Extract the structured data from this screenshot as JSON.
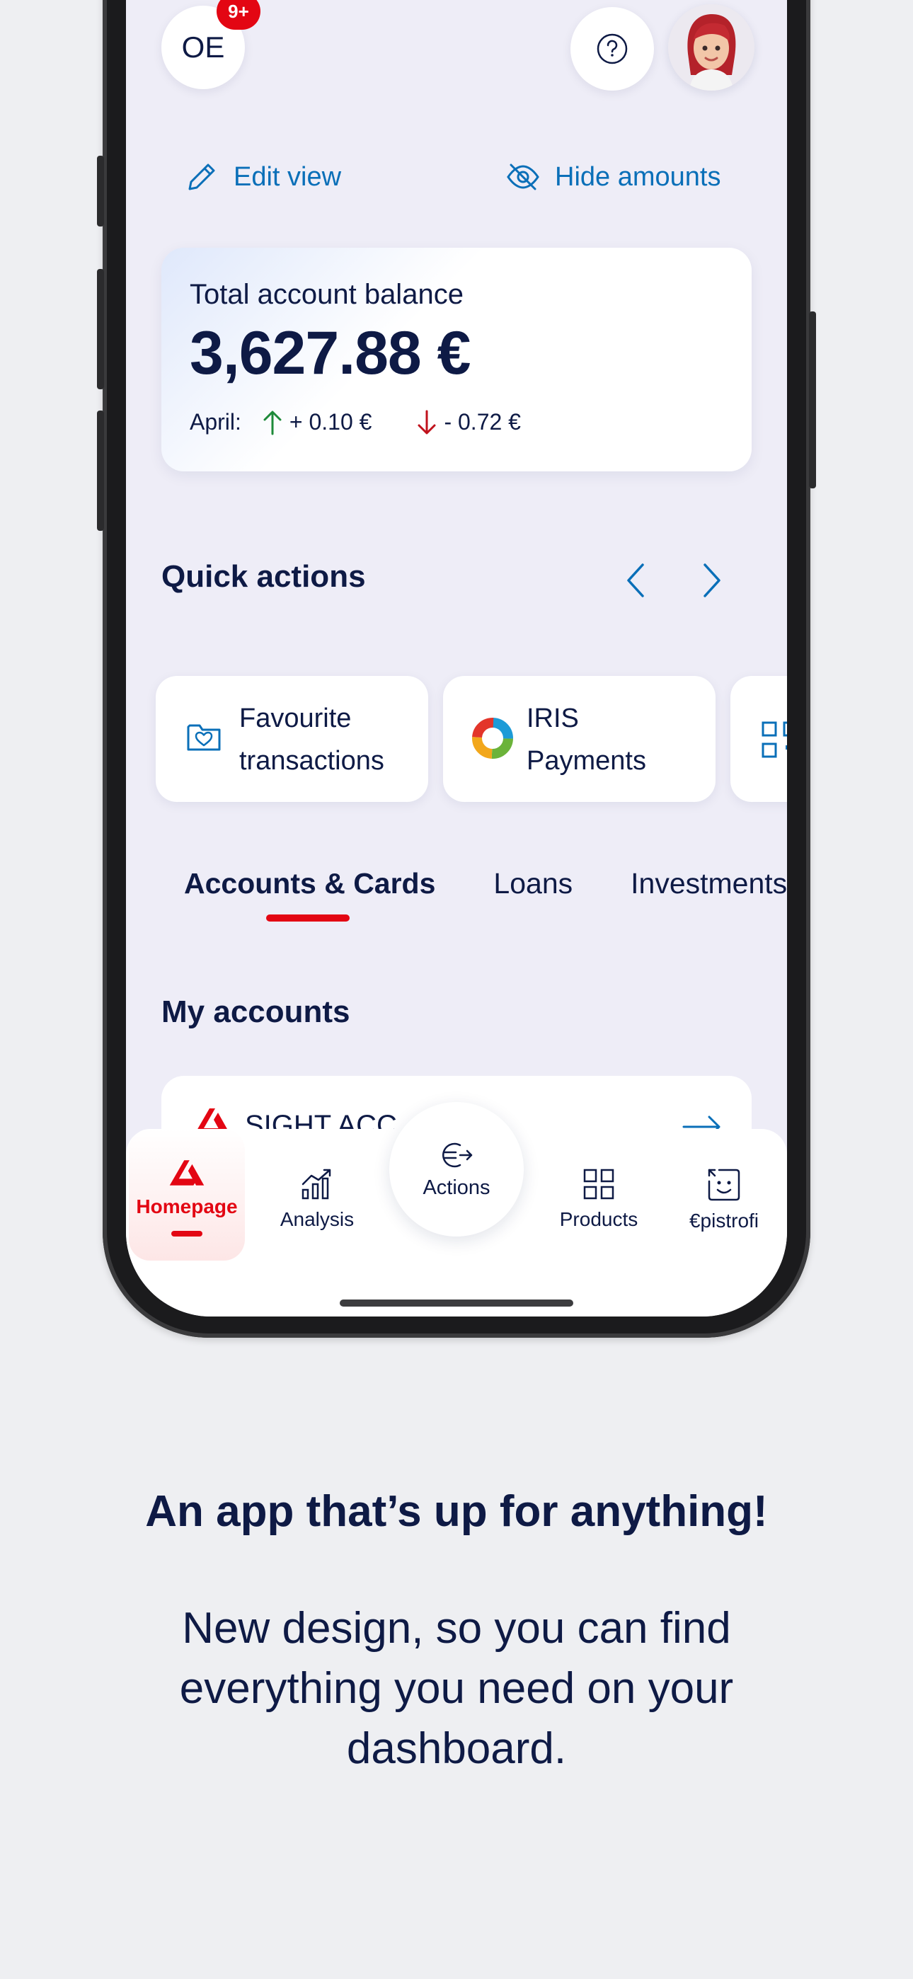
{
  "header": {
    "initials": "OE",
    "notification_count": "9+"
  },
  "view_controls": {
    "edit_label": "Edit view",
    "hide_label": "Hide amounts"
  },
  "balance": {
    "label": "Total account balance",
    "amount": "3,627.88 €",
    "month_label": "April:",
    "income": "+ 0.10 €",
    "expense": "- 0.72 €"
  },
  "quick_actions": {
    "title": "Quick actions",
    "items": [
      {
        "line1": "Favourite",
        "line2": "transactions",
        "icon": "folder-heart-icon"
      },
      {
        "line1": "IRIS",
        "line2": "Payments",
        "icon": "iris-logo-icon"
      }
    ]
  },
  "tabs": [
    {
      "label": "Accounts & Cards",
      "active": true
    },
    {
      "label": "Loans",
      "active": false
    },
    {
      "label": "Investments",
      "active": false
    }
  ],
  "accounts": {
    "title": "My accounts",
    "first_account": "SIGHT ACC"
  },
  "bottom_nav": {
    "homepage": "Homepage",
    "analysis": "Analysis",
    "actions": "Actions",
    "products": "Products",
    "epistrofi": "€pistrofi"
  },
  "marketing": {
    "headline": "An app that’s up for anything!",
    "subline": "New design, so you can find everything you need on your dashboard."
  },
  "colors": {
    "brand_red": "#e30613",
    "link_blue": "#0a6fb8",
    "navy_text": "#0e1a45",
    "up_green": "#1e8a3a"
  }
}
